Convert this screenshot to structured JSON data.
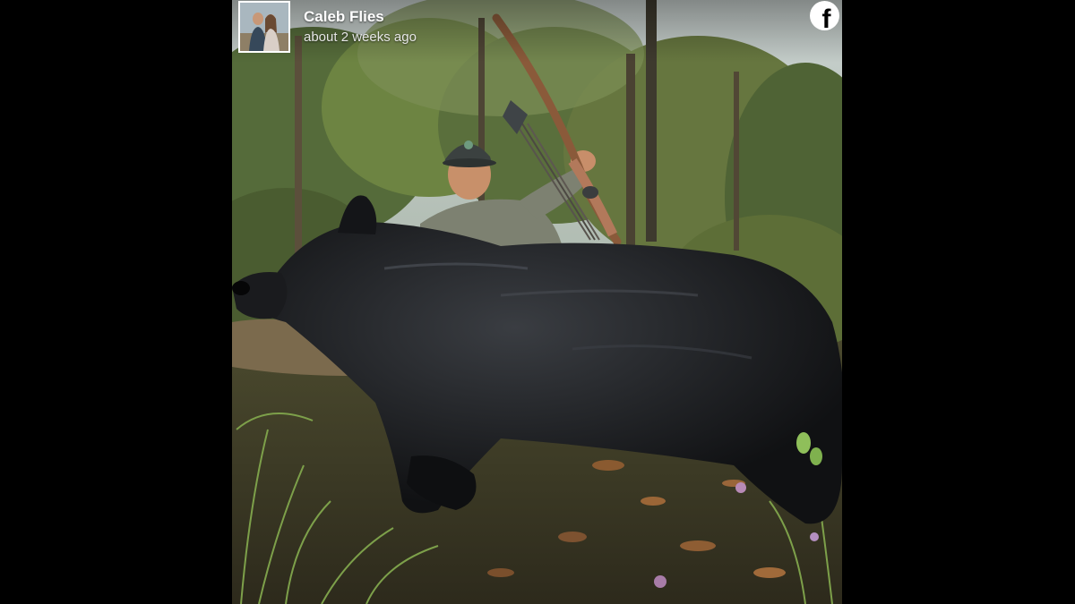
{
  "post": {
    "author_name": "Caleb Flies",
    "timestamp": "about 2 weeks ago",
    "avatar_icon": "profile-photo",
    "platform_icon": "facebook-icon",
    "platform_glyph": "f"
  },
  "colors": {
    "page_background": "#000000",
    "header_text": "#ffffff",
    "subtext": "#e6e6e6"
  }
}
